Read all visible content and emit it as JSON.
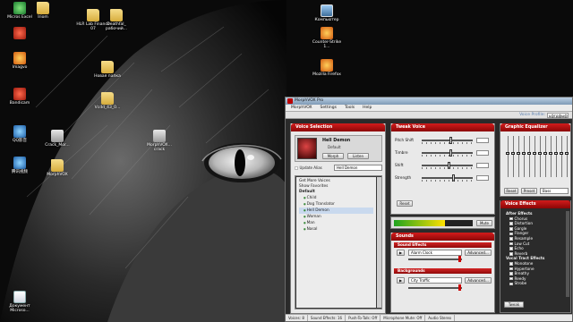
{
  "desktop": {
    "icons": [
      {
        "label": "Micros Excel",
        "kind": "green"
      },
      {
        "label": "Iriom",
        "kind": "folder"
      },
      {
        "label": "HLR Lab Finance 07",
        "kind": "folder"
      },
      {
        "label": "Deathfal_ рабочий...",
        "kind": "folder"
      },
      {
        "label": "Компьютер",
        "kind": "monitor"
      },
      {
        "label": "",
        "kind": "red"
      },
      {
        "label": "Counter-Strike 1...",
        "kind": "orange"
      },
      {
        "label": "Imagvo",
        "kind": "orange"
      },
      {
        "label": "Новая папка",
        "kind": "folder"
      },
      {
        "label": "Mozilla Firefox",
        "kind": "orange"
      },
      {
        "label": "Bandicam",
        "kind": "red"
      },
      {
        "label": "Vcdd_43_0...",
        "kind": "folder"
      },
      {
        "label": "QQ影音",
        "kind": "blue"
      },
      {
        "label": "Crack_Mor...",
        "kind": "grey"
      },
      {
        "label": "MorphVOX... crack",
        "kind": "grey"
      },
      {
        "label": "腾讯视频",
        "kind": "blue"
      },
      {
        "label": "MorphVOX",
        "kind": "folder"
      },
      {
        "label": "Документ Microso...",
        "kind": "doc"
      }
    ]
  },
  "app": {
    "title": "MorphVOX Pro",
    "menu": [
      "MorphVOX",
      "Settings",
      "Tools",
      "Help"
    ],
    "voice_profile_label": "Voice Profile:",
    "voice_profile_value": "ьфгдфыф",
    "voice_selection": {
      "header": "Voice Selection",
      "voice_name": "Hell Demon",
      "voice_sub": "Default",
      "morph_label": "Morph",
      "listen_label": "Listen",
      "update_alias": "Update Alias",
      "alias_value": "Hell Demon",
      "links": [
        "Get More Voices",
        "Show Favorites"
      ],
      "tree_group": "Default",
      "tree_items": [
        "Child",
        "Dog Translator",
        "Hell Demon",
        "Woman",
        "Man",
        "Nasal"
      ]
    },
    "tweak_voice": {
      "header": "Tweak Voice",
      "sliders": [
        {
          "label": "Pitch Shift",
          "value": 0.55
        },
        {
          "label": "Timbre",
          "value": 0.55
        },
        {
          "label": "Shift",
          "value": 0.5
        },
        {
          "label": "Strength",
          "value": 0.6
        }
      ],
      "reset_label": "Reset",
      "mute_label": "Mute",
      "level": 0.65
    },
    "graphic_equalizer": {
      "header": "Graphic Equalizer",
      "bands": [
        0.58,
        0.58,
        0.58,
        0.58,
        0.58,
        0.58,
        0.58,
        0.58,
        0.58,
        0.58,
        0.58,
        0.58
      ],
      "reset_label": "Reset",
      "preset_label": "Preset",
      "preset_value": "Bass"
    },
    "sounds": {
      "header": "Sounds",
      "sound_effects_label": "Sound Effects",
      "sound_effects_value": "Alarm Clock",
      "backgrounds_label": "Backgrounds",
      "backgrounds_value": "City Traffic",
      "advanced_label": "Advanced..."
    },
    "voice_effects": {
      "header": "Voice Effects",
      "after_effects_title": "After Effects",
      "after_effects": [
        "Chorus",
        "Distortion",
        "Gargle",
        "Flanger",
        "Resample",
        "Low Cut",
        "Echo",
        "Reverb"
      ],
      "vocal_tract_title": "Vocal Tract Effects",
      "vocal_tract": [
        "Monotone",
        "Hypertone",
        "Breathy",
        "Reedy",
        "Strobe"
      ],
      "tweak_label": "Tweak"
    },
    "status": [
      "Voices: 8",
      "Sound Effects: 16",
      "Push-To-Talk: Off",
      "Microphone Mute: Off",
      "Audio Stereo"
    ]
  }
}
